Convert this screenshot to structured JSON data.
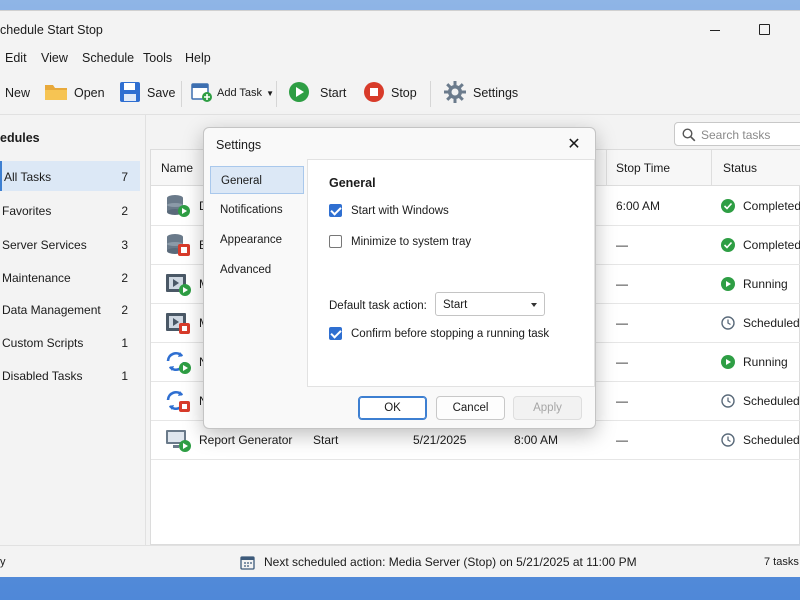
{
  "window": {
    "title": "chedule Start Stop"
  },
  "menu": [
    "Edit",
    "View",
    "Schedule",
    "Tools",
    "Help"
  ],
  "toolbar": {
    "new_label": "New",
    "open_label": "Open",
    "save_label": "Save",
    "add_task_label": "Add Task",
    "start_label": "Start",
    "stop_label": "Stop",
    "settings_label": "Settings"
  },
  "sidebar": {
    "heading": "edules",
    "items": [
      {
        "label": "All Tasks",
        "count": "7"
      },
      {
        "label": "Favorites",
        "count": "2"
      },
      {
        "label": "Server Services",
        "count": "3"
      },
      {
        "label": "Maintenance",
        "count": "2"
      },
      {
        "label": "Data Management",
        "count": "2"
      },
      {
        "label": "Custom Scripts",
        "count": "1"
      },
      {
        "label": "Disabled Tasks",
        "count": "1"
      }
    ]
  },
  "search": {
    "placeholder": "Search tasks"
  },
  "table": {
    "columns": {
      "name": "Name",
      "stop_time": "Stop Time",
      "status": "Status"
    },
    "rows": [
      {
        "name": "D",
        "stop_time": "6:00 AM",
        "status": "Completed",
        "icon": "database-start-icon"
      },
      {
        "name": "B",
        "stop_time": "—",
        "status": "Completed",
        "icon": "database-stop-icon"
      },
      {
        "name": "M",
        "stop_time": "—",
        "status": "Running",
        "icon": "media-start-icon"
      },
      {
        "name": "M",
        "stop_time": "—",
        "status": "Scheduled",
        "icon": "media-stop-icon"
      },
      {
        "name": "N",
        "stop_time": "—",
        "status": "Running",
        "icon": "sync-start-icon"
      },
      {
        "name": "N",
        "stop_time": "—",
        "status": "Scheduled",
        "icon": "sync-stop-icon"
      },
      {
        "name": "Report Generator",
        "action": "Start",
        "date": "5/21/2025",
        "time": "8:00 AM",
        "stop_time": "—",
        "status": "Scheduled",
        "icon": "monitor-start-icon"
      }
    ]
  },
  "statusbar": {
    "left": "y",
    "next_action": "Next scheduled action:  Media Server (Stop) on 5/21/2025 at 11:00 PM",
    "count": "7 tasks"
  },
  "dialog": {
    "title": "Settings",
    "nav": [
      "General",
      "Notifications",
      "Appearance",
      "Advanced"
    ],
    "panel_title": "General",
    "options": [
      {
        "label": "Start with Windows",
        "checked": true
      },
      {
        "label": "Minimize to system tray",
        "checked": false
      },
      {
        "label": "Confirm before stopping a running task",
        "checked": true
      }
    ],
    "default_action_label": "Default task action:",
    "default_action_value": "Start",
    "ok_label": "OK",
    "cancel_label": "Cancel",
    "apply_label": "Apply"
  },
  "colors": {
    "accent": "#3d7fd1",
    "completed": "#2e9e44",
    "running": "#2e9e44",
    "stop": "#d83b2a"
  }
}
